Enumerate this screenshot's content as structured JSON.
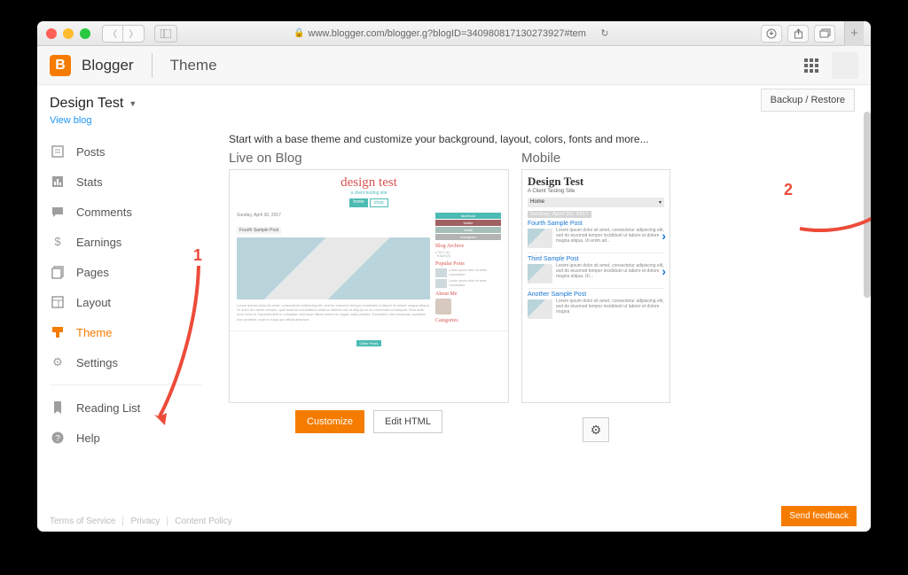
{
  "browser": {
    "url": "www.blogger.com/blogger.g?blogID=340980817130273927#tem"
  },
  "header": {
    "brand": "Blogger",
    "section": "Theme"
  },
  "blog": {
    "name": "Design Test",
    "view_link": "View blog"
  },
  "sidebar": {
    "items": [
      {
        "label": "Posts",
        "icon": "posts"
      },
      {
        "label": "Stats",
        "icon": "stats"
      },
      {
        "label": "Comments",
        "icon": "comments"
      },
      {
        "label": "Earnings",
        "icon": "earnings"
      },
      {
        "label": "Pages",
        "icon": "pages"
      },
      {
        "label": "Layout",
        "icon": "layout"
      },
      {
        "label": "Theme",
        "icon": "theme",
        "active": true
      },
      {
        "label": "Settings",
        "icon": "settings"
      }
    ],
    "secondary": [
      {
        "label": "Reading List"
      },
      {
        "label": "Help"
      }
    ]
  },
  "content": {
    "intro": "Start with a base theme and customize your background, layout, colors, fonts and more...",
    "backup_button": "Backup / Restore",
    "live_label": "Live on Blog",
    "mobile_label": "Mobile",
    "customize": "Customize",
    "edit_html": "Edit HTML"
  },
  "live_preview": {
    "title": "design test",
    "subtitle": "a client testing site",
    "tabs": [
      "home",
      "shop"
    ],
    "date": "Sunday, April 30, 2017",
    "post_title": "Fourth Sample Post",
    "body": "Lorem ipsum dolor sit amet, consectetur adipiscing elit, sed do eiusmod tempor incididunt ut labore et dolore magna aliqua. Ut enim ad minim veniam, quis nostrud exercitation ullamco laboris nisi ut aliquip ex ea commodo consequat. Duis aute irure dolor in reprehenderit in voluptate velit esse cillum dolore eu fugiat nulla pariatur. Excepteur sint occaecat cupidatat non proident, sunt in culpa qui officia deserunt.",
    "social": [
      {
        "label": "facebook",
        "color": "#4cbbb4"
      },
      {
        "label": "twitter",
        "color": "#9f6162"
      },
      {
        "label": "email",
        "color": "#a8bfb9"
      },
      {
        "label": "instagram",
        "color": "#b3b3b3"
      }
    ],
    "side_headings": {
      "archive": "Blog Archive",
      "popular": "Popular Posts",
      "about": "About Me",
      "categories": "Categories"
    },
    "footer_btn": "Older Posts"
  },
  "mobile_preview": {
    "title": "Design Test",
    "subtitle": "A Client Testing Site",
    "home": "Home",
    "date": "Sunday, April 30, 2017",
    "posts": [
      {
        "title": "Fourth Sample Post",
        "body": "Lorem ipsum dolor sit amet, consectetur adipiscing elit, sed do eiusmod tempor incididunt ut labore et dolore magna aliqua. Ut enim ad..."
      },
      {
        "title": "Third Sample Post",
        "body": "Lorem ipsum dolor sit amet, consectetur adipiscing elit, sed do eiusmod tempor incididunt ut labore et dolore magna aliqua. Ut..."
      },
      {
        "title": "Another Sample Post",
        "body": "Lorem ipsum dolor sit amet, consectetur adipiscing elit, sed do eiusmod tempor incididunt ut labore et dolore magna"
      }
    ]
  },
  "footer": {
    "links": [
      "Terms of Service",
      "Privacy",
      "Content Policy"
    ],
    "feedback": "Send feedback"
  },
  "annotations": {
    "one": "1",
    "two": "2"
  }
}
